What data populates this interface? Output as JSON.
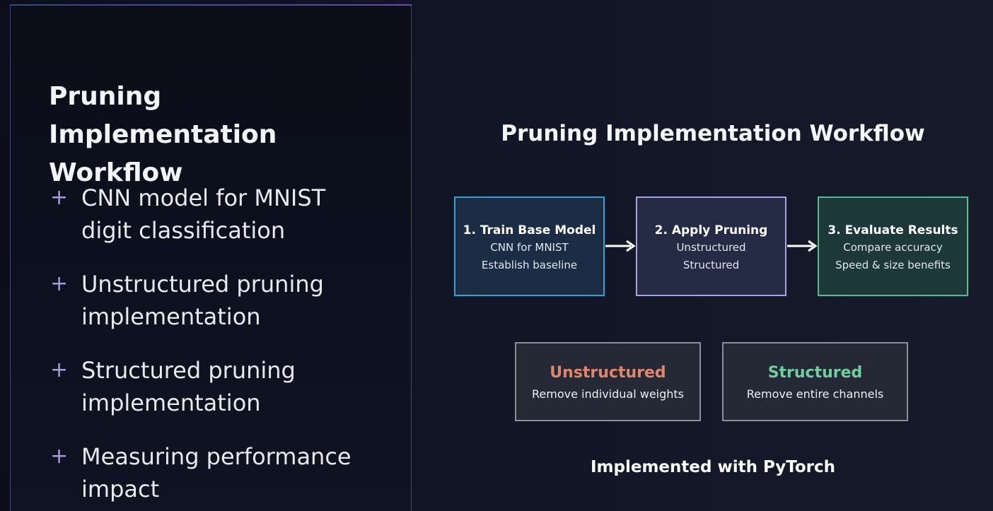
{
  "left": {
    "title": "Pruning Implementation Workflow",
    "bullets": [
      "CNN model for MNIST digit classification",
      "Unstructured pruning implementation",
      "Structured pruning implementation",
      "Measuring performance impact"
    ],
    "bullet_marker": "+"
  },
  "diagram": {
    "title": "Pruning Implementation Workflow",
    "steps": [
      {
        "title": "1. Train Base Model",
        "lines": [
          "CNN for MNIST",
          "Establish baseline"
        ],
        "color": "#34a3d3"
      },
      {
        "title": "2. Apply Pruning",
        "lines": [
          "Unstructured",
          "Structured"
        ],
        "color": "#a9a3e6"
      },
      {
        "title": "3. Evaluate Results",
        "lines": [
          "Compare accuracy",
          "Speed & size benefits"
        ],
        "color": "#4fbf92"
      }
    ],
    "types": [
      {
        "name": "Unstructured",
        "desc": "Remove individual weights",
        "color": "#e0866a"
      },
      {
        "name": "Structured",
        "desc": "Remove entire channels",
        "color": "#6fcf9e"
      }
    ],
    "footer": "Implemented with PyTorch"
  },
  "icons": {
    "bullet": "plus-icon",
    "connector": "arrow-right-icon"
  }
}
